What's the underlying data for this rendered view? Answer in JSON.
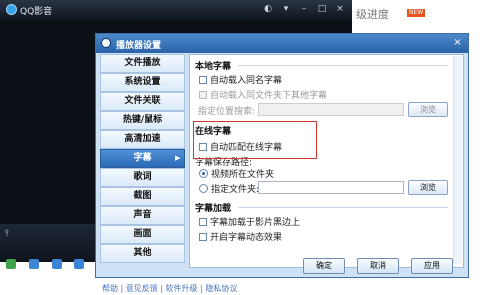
{
  "player": {
    "title": "QQ影音",
    "right_text": "级进度",
    "badge": "NEW",
    "footer_links": "帮助 | 意见反馈 | 软件升级 | 隐私协议"
  },
  "dialog": {
    "title": "播放器设置",
    "close": "×",
    "nav": [
      {
        "label": "文件播放"
      },
      {
        "label": "系统设置"
      },
      {
        "label": "文件关联"
      },
      {
        "label": "热键/鼠标"
      },
      {
        "label": "高清加速"
      },
      {
        "label": "字幕"
      },
      {
        "label": "歌词"
      },
      {
        "label": "截图"
      },
      {
        "label": "声音"
      },
      {
        "label": "画面"
      },
      {
        "label": "其他"
      }
    ],
    "active_index": 5,
    "local_subtitle": {
      "heading": "本地字幕",
      "auto_load_same_name": "自动载入同名字幕",
      "auto_load_other_in_folder": "自动载入同文件夹下其他字幕",
      "search_path_label": "指定位置搜索:",
      "search_path_value": "",
      "browse": "浏览"
    },
    "online_subtitle": {
      "heading": "在线字幕",
      "auto_match": "自动匹配在线字幕",
      "save_path_label": "字幕保存路径:",
      "radio_video_folder": "视频所在文件夹",
      "radio_custom_folder": "指定文件夹:",
      "custom_folder_value": "",
      "browse": "浏览"
    },
    "subtitle_enhance": {
      "heading": "字幕加载",
      "load_on_black_border": "字幕加载于影片黑边上",
      "enable_dynamic_effect": "开启字幕动态效果"
    },
    "buttons": {
      "ok": "确定",
      "cancel": "取消",
      "apply": "应用"
    }
  },
  "colors": {
    "accent": "#2b62a7",
    "highlight_box": "#d23434"
  }
}
